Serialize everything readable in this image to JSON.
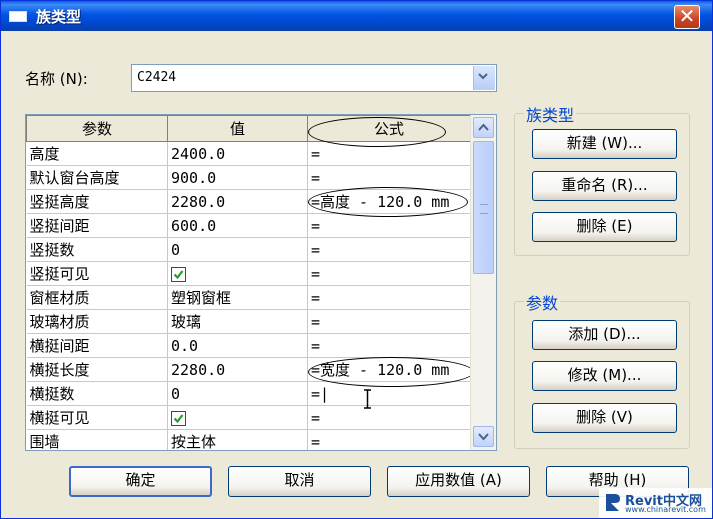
{
  "window": {
    "title": "族类型",
    "close_glyph": "✕"
  },
  "name_field": {
    "label": "名称 (N):",
    "value": "C2424"
  },
  "table": {
    "headers": [
      "参数",
      "值",
      "公式"
    ],
    "rows": [
      {
        "param": "高度",
        "value": "2400.0",
        "formula": "="
      },
      {
        "param": "默认窗台高度",
        "value": "900.0",
        "formula": "="
      },
      {
        "param": "竖挺高度",
        "value": "2280.0",
        "formula": "=高度 - 120.0 mm"
      },
      {
        "param": "竖挺间距",
        "value": "600.0",
        "formula": "="
      },
      {
        "param": "竖挺数",
        "value": "0",
        "formula": "="
      },
      {
        "param": "竖挺可见",
        "value": "",
        "checkbox": true,
        "formula": "="
      },
      {
        "param": "窗框材质",
        "value": "塑钢窗框",
        "formula": "="
      },
      {
        "param": "玻璃材质",
        "value": "玻璃",
        "formula": "="
      },
      {
        "param": "横挺间距",
        "value": "0.0",
        "formula": "="
      },
      {
        "param": "横挺长度",
        "value": "2280.0",
        "formula": "=宽度 - 120.0 mm"
      },
      {
        "param": "横挺数",
        "value": "0",
        "formula": "=|"
      },
      {
        "param": "横挺可见",
        "value": "",
        "checkbox": true,
        "formula": "="
      },
      {
        "param": "围墙",
        "value": "按主体",
        "formula": "="
      }
    ]
  },
  "family_types_group": {
    "title": "族类型",
    "new_label": "新建 (W)...",
    "rename_label": "重命名 (R)...",
    "delete_label": "删除 (E)"
  },
  "params_group": {
    "title": "参数",
    "add_label": "添加 (D)...",
    "modify_label": "修改 (M)...",
    "delete_label": "删除 (V)"
  },
  "footer": {
    "ok_label": "确定",
    "cancel_label": "取消",
    "apply_label": "应用数值 (A)",
    "help_label": "帮助 (H)"
  },
  "watermark": {
    "brand": "Revit中文网",
    "url": "www.chinarevit.com"
  },
  "colors": {
    "titlebar": "#0054e3",
    "accent": "#0046d5",
    "check": "#21a121"
  }
}
